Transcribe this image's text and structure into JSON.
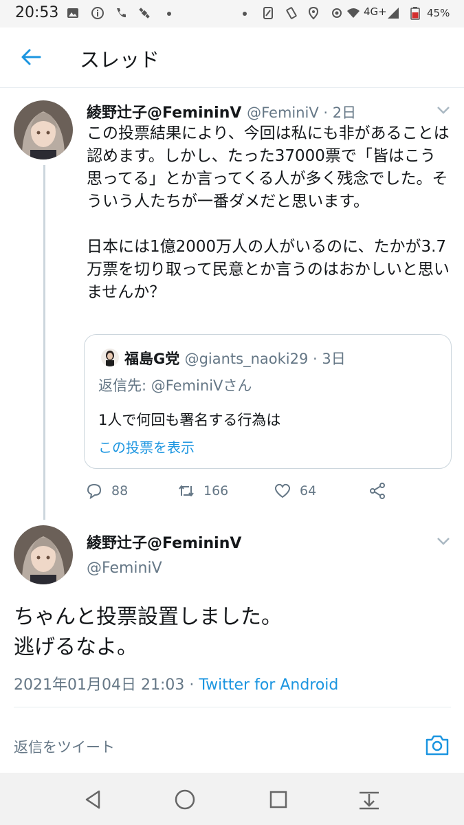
{
  "status_bar": {
    "time": "20:53",
    "network": "4G+",
    "battery": "45%"
  },
  "header": {
    "title": "スレッド"
  },
  "tweet1": {
    "name": "綾野辻子@FemininV",
    "meta": "@FeminiV · 2日",
    "body": "この投票結果により、今回は私にも非があることは認めます。しかし、たった37000票で「皆はこう思ってる」とか言ってくる人が多く残念でした。そういう人たちが一番ダメだと思います。\n\n日本には1億2000万人の人がいるのに、たかが3.7万票を切り取って民意とか言うのはおかしいと思いませんか？",
    "quote": {
      "name": "福島G党",
      "meta": "@giants_naoki29 · 3日",
      "reply_to": "返信先: @FeminiVさん",
      "text": "1人で何回も署名する行為は",
      "link": "この投票を表示"
    },
    "actions": {
      "replies": "88",
      "retweets": "166",
      "likes": "64"
    }
  },
  "tweet2": {
    "name": "綾野辻子@FemininV",
    "handle": "@FeminiV",
    "body": "ちゃんと投票設置しました。\n逃げるなよ。",
    "timestamp": "2021年01月04日 21:03 · ",
    "client": "Twitter for Android"
  },
  "reply_bar": {
    "placeholder": "返信をツイート"
  },
  "colors": {
    "accent": "#1b95e0",
    "secondary_text": "#657786",
    "border": "#ccd6dd"
  }
}
